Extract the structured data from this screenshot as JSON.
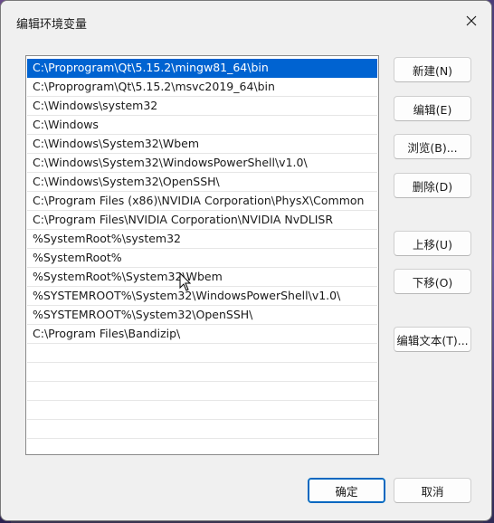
{
  "window": {
    "title": "编辑环境变量"
  },
  "paths": [
    "C:\\Proprogram\\Qt\\5.15.2\\mingw81_64\\bin",
    "C:\\Proprogram\\Qt\\5.15.2\\msvc2019_64\\bin",
    "C:\\Windows\\system32",
    "C:\\Windows",
    "C:\\Windows\\System32\\Wbem",
    "C:\\Windows\\System32\\WindowsPowerShell\\v1.0\\",
    "C:\\Windows\\System32\\OpenSSH\\",
    "C:\\Program Files (x86)\\NVIDIA Corporation\\PhysX\\Common",
    "C:\\Program Files\\NVIDIA Corporation\\NVIDIA NvDLISR",
    "%SystemRoot%\\system32",
    "%SystemRoot%",
    "%SystemRoot%\\System32\\Wbem",
    "%SYSTEMROOT%\\System32\\WindowsPowerShell\\v1.0\\",
    "%SYSTEMROOT%\\System32\\OpenSSH\\",
    "C:\\Program Files\\Bandizip\\",
    "",
    "",
    "",
    "",
    "",
    ""
  ],
  "selected_index": 0,
  "buttons": {
    "new": "新建(N)",
    "edit": "编辑(E)",
    "browse": "浏览(B)...",
    "delete": "删除(D)",
    "move_up": "上移(U)",
    "move_down": "下移(O)",
    "edit_text": "编辑文本(T)...",
    "ok": "确定",
    "cancel": "取消"
  },
  "colors": {
    "selection": "#0063d1",
    "primary_border": "#0067c0"
  }
}
